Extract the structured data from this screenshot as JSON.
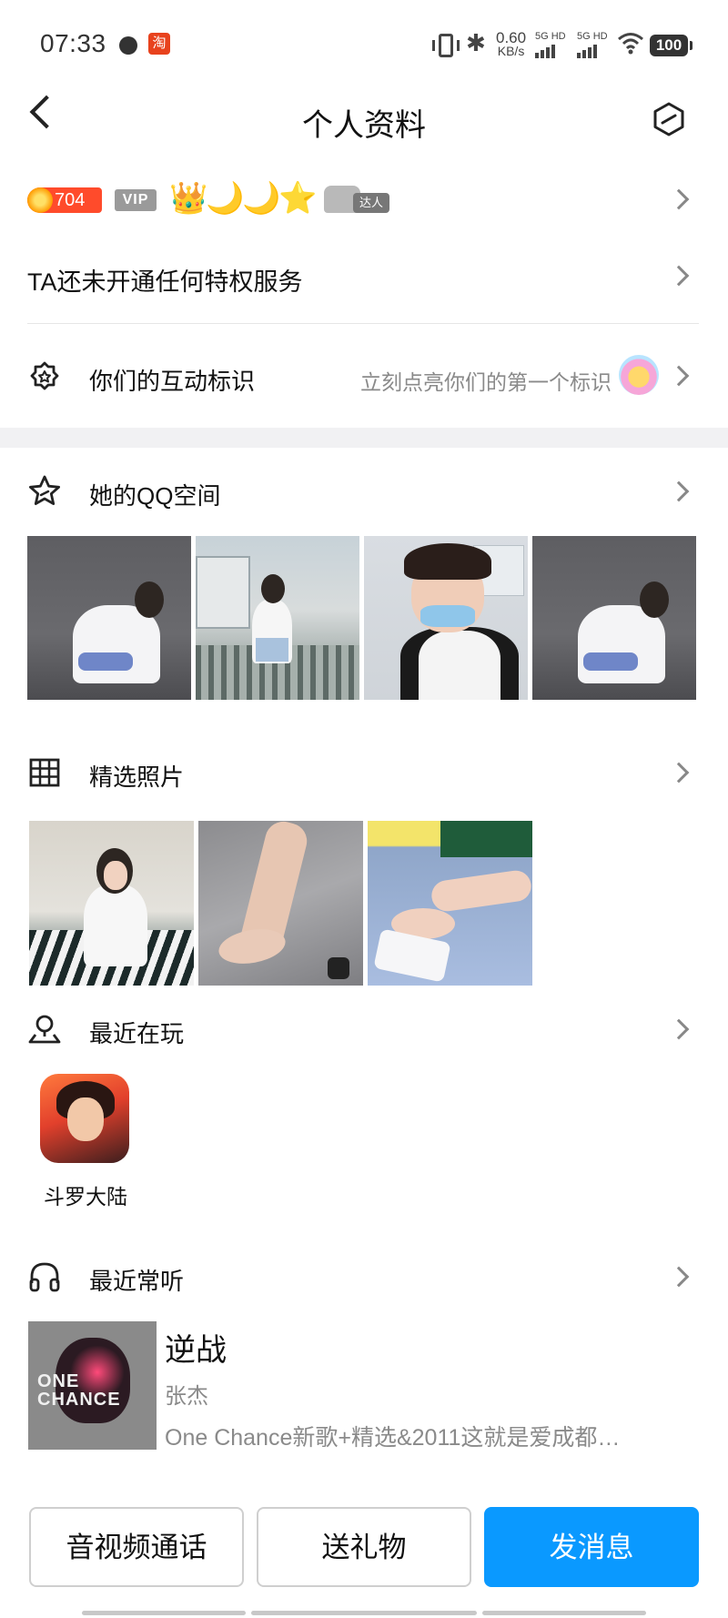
{
  "status_bar": {
    "time": "07:33",
    "taobao_badge": "淘",
    "net_speed_value": "0.60",
    "net_speed_unit": "KB/s",
    "sim1_label": "5G HD",
    "sim2_label": "5G HD",
    "battery": "100"
  },
  "header": {
    "title": "个人资料",
    "back_icon": "chevron-left-icon",
    "settings_icon": "hexagon-settings-icon"
  },
  "badges": {
    "level": "704",
    "vip": "VIP",
    "crown": "👑",
    "moon1": "🌙",
    "moon2": "🌙",
    "star": "⭐",
    "expert_tag": "达人"
  },
  "privilege": {
    "text": "TA还未开通任何特权服务"
  },
  "interaction": {
    "title": "你们的互动标识",
    "hint": "立刻点亮你们的第一个标识"
  },
  "qzone": {
    "title": "她的QQ空间"
  },
  "featured_photos": {
    "title": "精选照片"
  },
  "recent_games": {
    "title": "最近在玩",
    "games": [
      {
        "name": "斗罗大陆"
      }
    ]
  },
  "recent_music": {
    "title": "最近常听",
    "song": "逆战",
    "artist": "张杰",
    "album": "One Chance新歌+精选&2011这就是爱成都…",
    "cover_text_line1": "ONE",
    "cover_text_line2": "CHANCE"
  },
  "actions": {
    "call": "音视频通话",
    "gift": "送礼物",
    "message": "发消息"
  },
  "colors": {
    "primary": "#0a99ff",
    "level_badge": "#ff4b2b",
    "hint_text": "#8a8a8a"
  }
}
